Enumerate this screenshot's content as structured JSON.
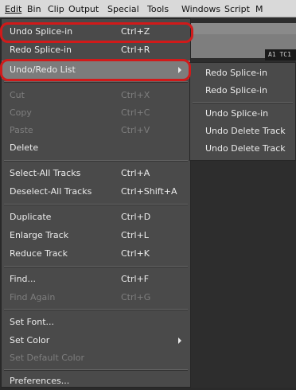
{
  "menubar": {
    "items": [
      "Edit",
      "Bin",
      "Clip",
      "Output",
      "Special",
      "Tools",
      "Windows",
      "Script",
      "M"
    ]
  },
  "background": {
    "timecode_label": "A1 TC1"
  },
  "edit_menu": {
    "items": [
      {
        "label": "Undo Splice-in",
        "shortcut": "Ctrl+Z"
      },
      {
        "label": "Redo Splice-in",
        "shortcut": "Ctrl+R"
      },
      {
        "label": "Undo/Redo List",
        "shortcut": ""
      },
      {
        "label": "Cut",
        "shortcut": "Ctrl+X"
      },
      {
        "label": "Copy",
        "shortcut": "Ctrl+C"
      },
      {
        "label": "Paste",
        "shortcut": "Ctrl+V"
      },
      {
        "label": "Delete",
        "shortcut": ""
      },
      {
        "label": "Select-All Tracks",
        "shortcut": "Ctrl+A"
      },
      {
        "label": "Deselect-All Tracks",
        "shortcut": "Ctrl+Shift+A"
      },
      {
        "label": "Duplicate",
        "shortcut": "Ctrl+D"
      },
      {
        "label": "Enlarge Track",
        "shortcut": "Ctrl+L"
      },
      {
        "label": "Reduce Track",
        "shortcut": "Ctrl+K"
      },
      {
        "label": "Find...",
        "shortcut": "Ctrl+F"
      },
      {
        "label": "Find Again",
        "shortcut": "Ctrl+G"
      },
      {
        "label": "Set Font...",
        "shortcut": ""
      },
      {
        "label": "Set Color",
        "shortcut": ""
      },
      {
        "label": "Set Default Color",
        "shortcut": ""
      },
      {
        "label": "Preferences...",
        "shortcut": ""
      }
    ]
  },
  "undo_redo_submenu": {
    "items": [
      {
        "label": "Redo Splice-in"
      },
      {
        "label": "Redo Splice-in"
      },
      {
        "label": "Undo Splice-in"
      },
      {
        "label": "Undo Delete Track"
      },
      {
        "label": "Undo Delete Track"
      }
    ]
  },
  "colors": {
    "annotation": "#d11a1a",
    "menu_background": "#4a4a4a",
    "highlight": "#7c7c7c"
  }
}
